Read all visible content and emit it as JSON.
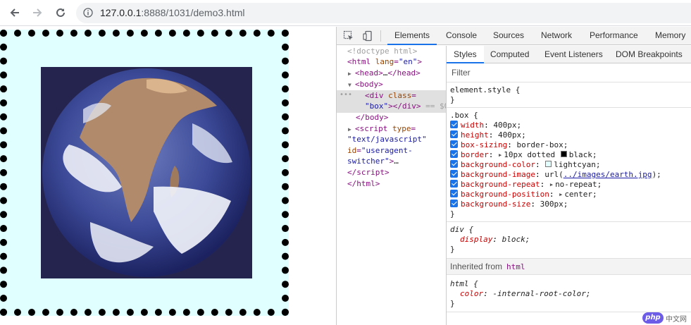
{
  "browser": {
    "url_host": "127.0.0.1",
    "url_rest": ":8888/1031/demo3.html"
  },
  "page": {
    "box": {
      "background_color": "#e0ffff",
      "border_color": "#000000",
      "image_alt": "earth"
    }
  },
  "devtools": {
    "tabs": [
      "Elements",
      "Console",
      "Sources",
      "Network",
      "Performance",
      "Memory"
    ],
    "active_tab": "Elements",
    "dom": {
      "doctype": "<!doctype html>",
      "html_open_tag": "html",
      "html_lang_attr": "lang",
      "html_lang_val": "\"en\"",
      "head": "head",
      "head_ellipsis": "…",
      "body": "body",
      "div_tag": "div",
      "div_class_attr": "class",
      "div_class_val": "\"box\"",
      "div_close": "div",
      "selected_marker": "== $0",
      "body_close": "body",
      "script_tag": "script",
      "script_type_attr": "type",
      "script_type_val": "\"text/javascript\"",
      "script_id_attr": "id",
      "script_id_val": "\"useragent-switcher\"",
      "script_ellipsis": "…",
      "script_close": "script",
      "html_close": "html"
    },
    "styles_tabs": [
      "Styles",
      "Computed",
      "Event Listeners",
      "DOM Breakpoints"
    ],
    "active_styles_tab": "Styles",
    "filter_placeholder": "Filter",
    "element_style": "element.style {",
    "close_brace": "}",
    "box_rule": {
      "selector": ".box {",
      "props": [
        {
          "name": "width",
          "value": "400px;"
        },
        {
          "name": "height",
          "value": "400px;"
        },
        {
          "name": "box-sizing",
          "value": "border-box;"
        },
        {
          "name": "border",
          "value": "10px dotted",
          "swatch": "#000000",
          "value2": "black;"
        },
        {
          "name": "background-color",
          "swatch": "#e0ffff",
          "value": "lightcyan;"
        },
        {
          "name": "background-image",
          "value": "url(",
          "link": "../images/earth.jpg",
          "value2": ");"
        },
        {
          "name": "background-repeat",
          "value": "no-repeat;"
        },
        {
          "name": "background-position",
          "value": "center;"
        },
        {
          "name": "background-size",
          "value": "300px;"
        }
      ]
    },
    "div_rule": {
      "selector": "div {",
      "prop": "display",
      "value": "block;"
    },
    "inherited_label": "Inherited from",
    "inherited_from": "html",
    "html_rule": {
      "selector": "html {",
      "prop": "color",
      "value": "-internal-root-color;"
    }
  },
  "watermark": {
    "logo": "php",
    "text": "中文网"
  }
}
